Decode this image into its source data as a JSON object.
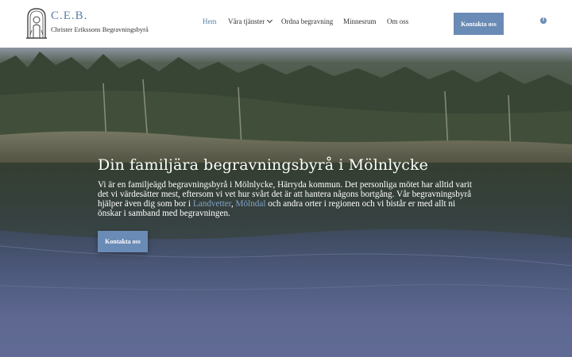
{
  "logo": {
    "title": "C.E.B.",
    "subtitle": "Christer Erikssons Begravningsbyrå"
  },
  "nav": {
    "items": [
      {
        "label": "Hem",
        "active": true
      },
      {
        "label": "Våra tjänster",
        "has_dropdown": true
      },
      {
        "label": "Ordna begravning"
      },
      {
        "label": "Minnesrum"
      },
      {
        "label": "Om oss"
      }
    ],
    "cta_label": "Kontakta oss",
    "social_icon": "facebook-icon"
  },
  "hero": {
    "title": "Din familjära begravningsbyrå i Mölnlycke",
    "text_part1": "Vi är en familjeägd begravningsbyrå i Mölnlycke, Härryda kommun. Det personliga mötet har alltid varit det vi värdesätter mest, eftersom vi vet hur svårt det är att hantera någons bortgång. Vår begravningsbyrå hjälper även dig som bor i ",
    "link1": "Landvetter",
    "separator": ", ",
    "link2": "Mölndal",
    "text_part2": " och andra orter i regionen och vi bistår er med allt ni önskar i samband med begravningen.",
    "cta_label": "Kontakta oss"
  },
  "colors": {
    "accent": "#6a8bb5",
    "link": "#7ea3cc",
    "logo_text": "#5a7fa6"
  }
}
